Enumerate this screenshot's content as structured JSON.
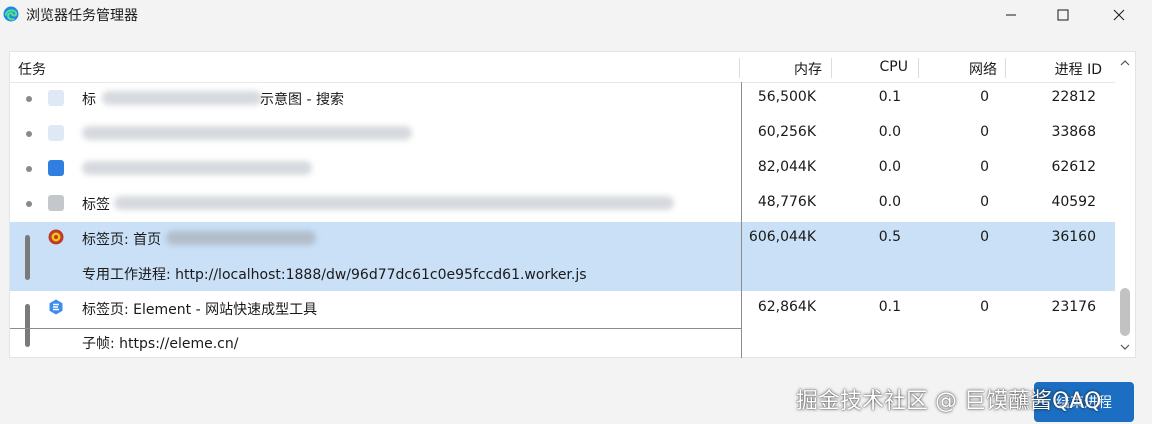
{
  "window": {
    "title": "浏览器任务管理器",
    "icon": "edge-icon"
  },
  "columns": {
    "task": "任务",
    "memory": "内存",
    "cpu": "CPU",
    "network": "网络",
    "pid": "进程 ID"
  },
  "rows": [
    {
      "title_prefix": "标",
      "title_suffix": "示意图 - 搜索",
      "memory": "56,500K",
      "cpu": "0.1",
      "network": "0",
      "pid": "22812"
    },
    {
      "title_prefix": "",
      "title_suffix": "",
      "memory": "60,256K",
      "cpu": "0.0",
      "network": "0",
      "pid": "33868"
    },
    {
      "title_prefix": "",
      "title_suffix": "",
      "memory": "82,044K",
      "cpu": "0.0",
      "network": "0",
      "pid": "62612"
    },
    {
      "title_prefix": "标签",
      "title_suffix": "",
      "memory": "48,776K",
      "cpu": "0.0",
      "network": "0",
      "pid": "40592"
    },
    {
      "title_prefix": "标签页: 首页",
      "title_suffix": "",
      "subtitle": "专用工作进程: http://localhost:1888/dw/96d77dc61c0e95fccd61.worker.js",
      "memory": "606,044K",
      "cpu": "0.5",
      "network": "0",
      "pid": "36160"
    },
    {
      "title_prefix": "标签页: Element - 网站快速成型工具",
      "title_suffix": "",
      "subtitle": "子帧: https://eleme.cn/",
      "memory": "62,864K",
      "cpu": "0.1",
      "network": "0",
      "pid": "23176"
    }
  ],
  "end_process_button": "结束进程",
  "watermark": "掘金技术社区 @ 巨馍蘸酱QAQ",
  "colors": {
    "selected_row": "#c9e0f7",
    "button": "#1b6ec2",
    "element_icon": "#3d8cf0",
    "shield_icon": "#c0392b"
  }
}
